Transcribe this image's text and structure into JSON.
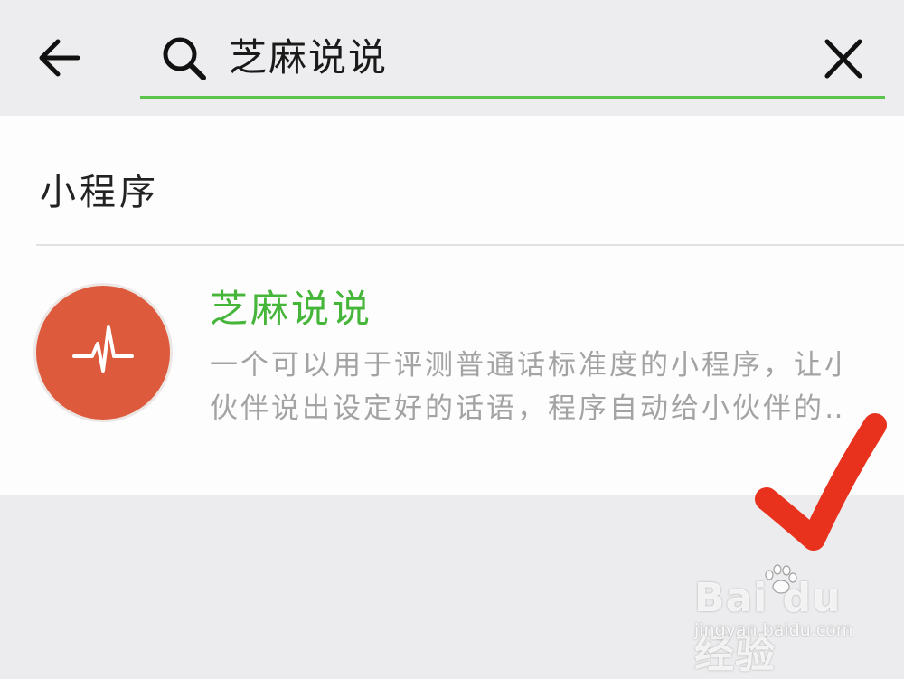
{
  "search": {
    "query": "芝麻说说"
  },
  "section": {
    "title": "小程序"
  },
  "result": {
    "name": "芝麻说说",
    "description_lines": [
      "一个可以用于评测普通话标准度的小程序，让小",
      "伙伴说出设定好的话语，程序自动给小伙伴的…"
    ],
    "icon": "pulse-icon",
    "icon_color": "#dd5a3c",
    "name_color": "#45b639"
  },
  "colors": {
    "accent": "#5cc44a",
    "annotation": "#e8321e"
  },
  "watermark": {
    "logo": "Bai du 经验",
    "url": "jingyan.baidu.com"
  }
}
